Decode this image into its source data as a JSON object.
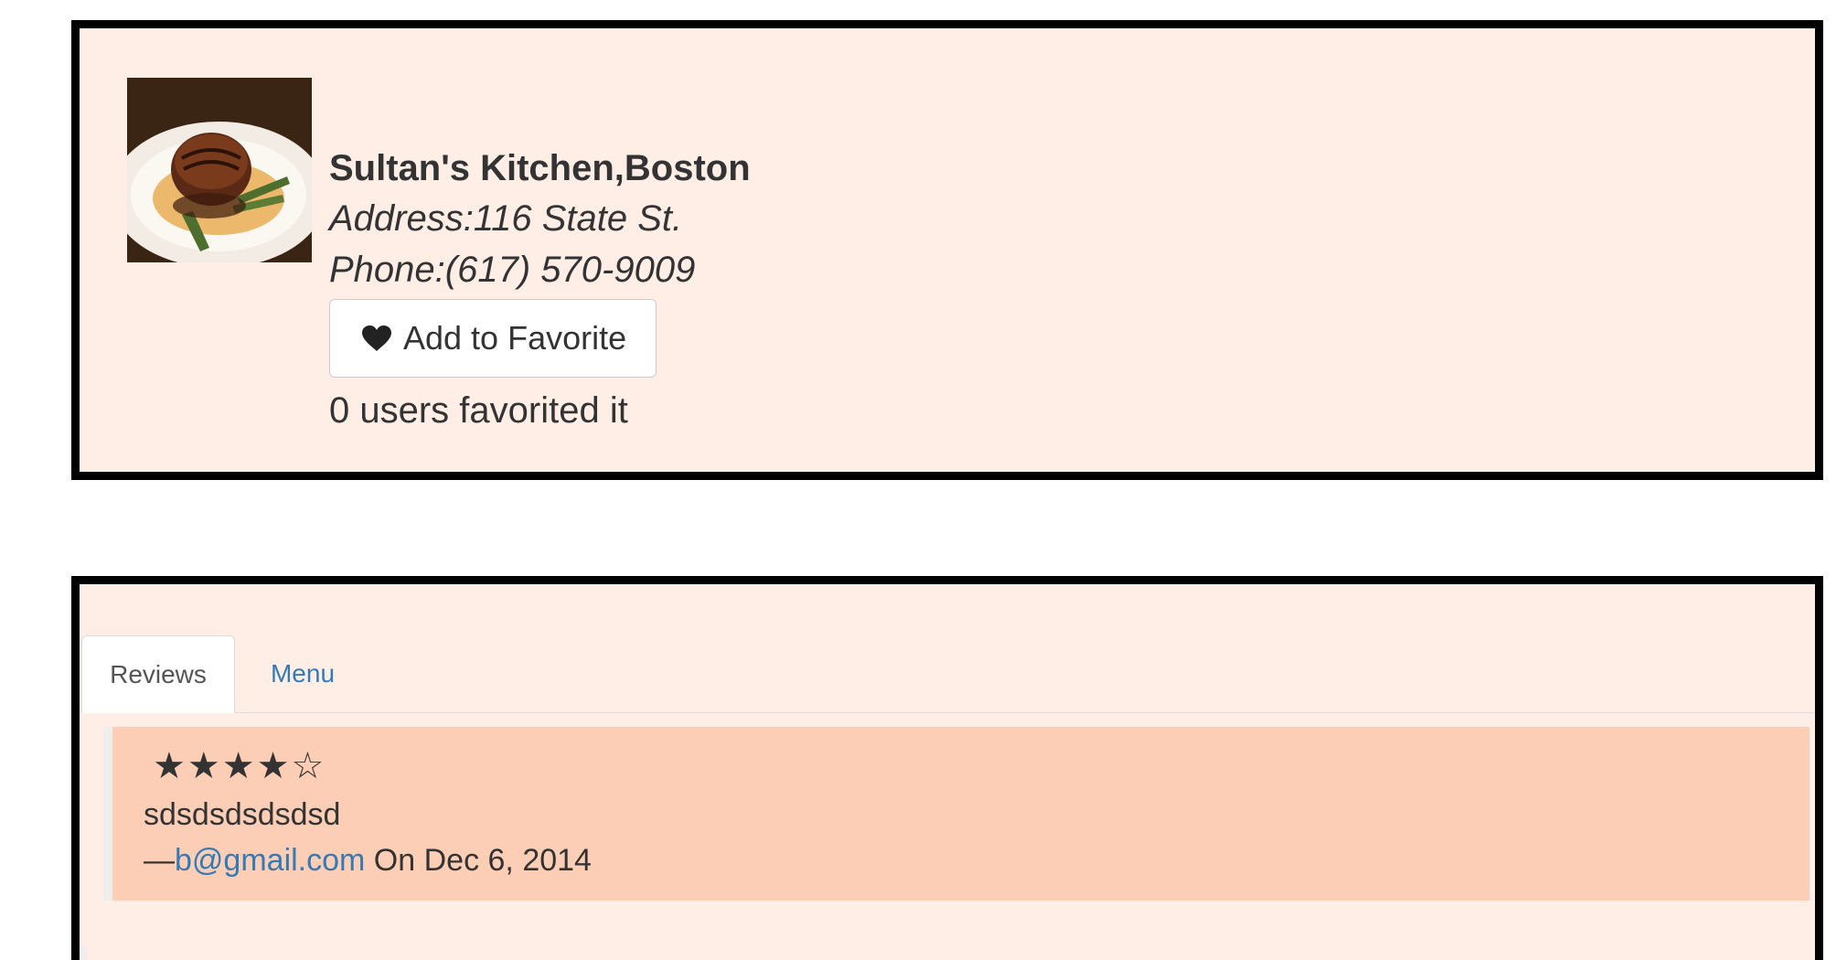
{
  "restaurant": {
    "name": "Sultan's Kitchen,Boston",
    "address": "Address:116 State St.",
    "phone": "Phone:(617) 570-9009",
    "photo_icon": "restaurant-photo",
    "favorite_button_label": "Add to Favorite",
    "favorite_icon": "heart-icon",
    "favorite_count": "0 users favorited it"
  },
  "tabs": [
    {
      "label": "Reviews",
      "active": true
    },
    {
      "label": "Menu",
      "active": false
    }
  ],
  "reviews": [
    {
      "stars": "★★★★☆",
      "rating": 4,
      "text": "sdsdsdsdsdsd",
      "dash": "—",
      "author": "b@gmail.com",
      "date": " On Dec 6, 2014"
    }
  ],
  "colors": {
    "card_background": "#feeee6",
    "review_background": "#fdceb6",
    "link": "#337ab7",
    "border": "#000000"
  }
}
